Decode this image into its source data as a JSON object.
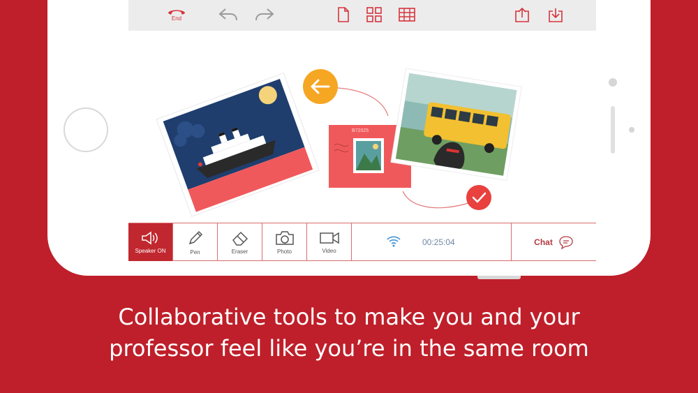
{
  "toolbar": {
    "end_label": "End",
    "icons": [
      "phone-end-icon",
      "undo-icon",
      "redo-icon",
      "blank-page-icon",
      "grid-view-icon",
      "table-icon",
      "upload-icon",
      "download-icon"
    ]
  },
  "tools": [
    {
      "label": "Speaker ON",
      "icon": "speaker-icon",
      "active": true
    },
    {
      "label": "Pen",
      "icon": "pen-icon",
      "active": false
    },
    {
      "label": "Eraser",
      "icon": "eraser-icon",
      "active": false
    },
    {
      "label": "Photo",
      "icon": "camera-icon",
      "active": false
    },
    {
      "label": "Video",
      "icon": "video-icon",
      "active": false
    }
  ],
  "status": {
    "timer": "00:25:04"
  },
  "chat": {
    "label": "Chat"
  },
  "stamp": {
    "code": "B72025"
  },
  "caption": {
    "line1": "Collaborative tools to make you and your",
    "line2": "professor feel like you’re in the same room"
  },
  "colors": {
    "brand_red": "#bf1f2a",
    "accent_orange": "#f5a623",
    "timer_blue": "#6f86a6"
  }
}
